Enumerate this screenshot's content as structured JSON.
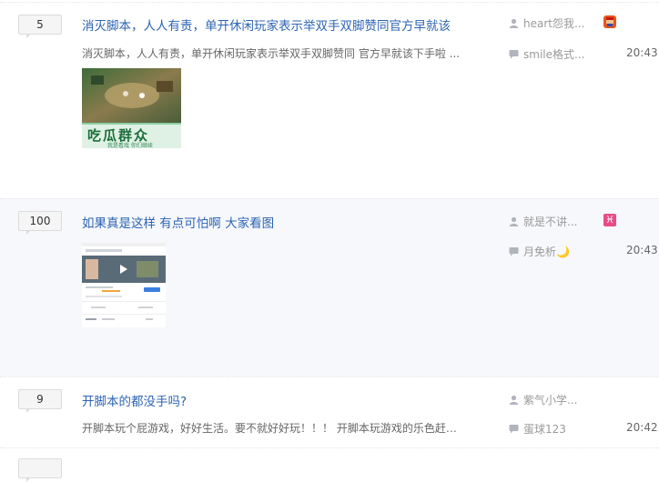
{
  "threads": [
    {
      "reply_count": "5",
      "title": "消灭脚本，人人有责，单开休闲玩家表示举双手双脚赞同官方早就该",
      "abstract": "消灭脚本，人人有责，单开休闲玩家表示举双手双脚赞同 官方早就该下手啦 ...",
      "image_caption": "吃瓜群众",
      "image_subcaption": "我是看戏 你们继续",
      "author": "heart怨我...",
      "last_replier": "smile格式...",
      "time": "20:43",
      "badge_icon": "mario-badge-icon",
      "badge_color": "#e8541e"
    },
    {
      "reply_count": "100",
      "title": "如果真是这样 有点可怕啊 大家看图",
      "abstract": "",
      "author": "就是不讲...",
      "last_replier": "月免析🌙",
      "time": "20:43",
      "badge_icon": "pisces-badge-icon",
      "badge_color": "#e84d8a"
    },
    {
      "reply_count": "9",
      "title": "开脚本的都没手吗?",
      "abstract": "开脚本玩个屁游戏，好好生活。要不就好好玩！！！ 开脚本玩游戏的乐色赶紧...",
      "author": "紫气小学...",
      "last_replier": "蛋球123",
      "time": "20:42"
    }
  ],
  "colors": {
    "title_link": "#2d64b3",
    "alt_row_bg": "#f7f8fc",
    "reply_box_bg": "#f5f5f5"
  }
}
